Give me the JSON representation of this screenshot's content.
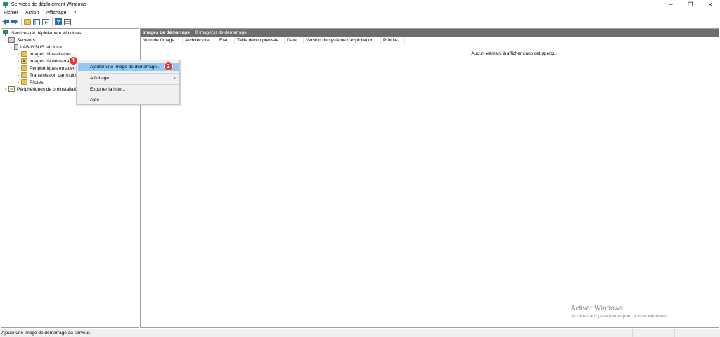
{
  "window": {
    "title": "Services de déploiement Windows",
    "controls": {
      "minimize": "─",
      "restore": "❐",
      "close": "✕"
    }
  },
  "menubar": {
    "items": [
      "Fichier",
      "Action",
      "Affichage",
      "?"
    ]
  },
  "toolbar": {
    "icons": [
      "arrow-left-icon",
      "arrow-right-icon",
      "folder-up-icon",
      "show-pane-icon",
      "export-icon",
      "help-icon",
      "properties-icon"
    ]
  },
  "tree": {
    "root": "Services de déploiement Windows",
    "servers": "Serveurs",
    "server": "LAB-WSUS.lab.intra",
    "children": [
      "Images d'installation",
      "Images de démarrage",
      "Périphériques en attente",
      "Transmission par multidiffusion",
      "Pilotes"
    ],
    "prestaged": "Périphériques de préinstallation",
    "twisty_collapsed": "›",
    "twisty_expanded": "⌄"
  },
  "main": {
    "header_title": "Images de démarrage",
    "header_count": "0 image(s) de démarrage",
    "columns": [
      "Nom de l'image",
      "Architecture",
      "État",
      "Taille décompressée",
      "Date",
      "Version du système d'exploitation",
      "Priorité"
    ],
    "empty_message": "Aucun élément à afficher dans cet aperçu."
  },
  "context_menu": {
    "items": [
      "Ajouter une image de démarrage...",
      "Affichage",
      "Exporter la liste...",
      "Aide"
    ],
    "submenu_arrow": "›"
  },
  "badges": [
    "1",
    "2"
  ],
  "statusbar": {
    "text": "Ajoute une image de démarrage au serveur."
  },
  "watermark": {
    "title": "Activer Windows",
    "subtitle": "Accédez aux paramètres pour activer Windows."
  }
}
